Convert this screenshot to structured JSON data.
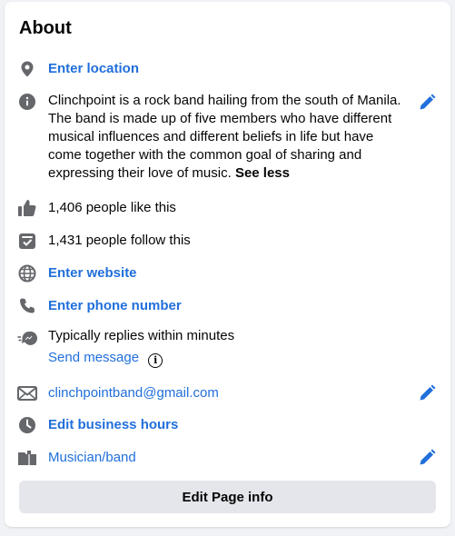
{
  "about": {
    "title": "About",
    "location": {
      "label": "Enter location",
      "icon": "location-pin-icon"
    },
    "description": {
      "text": "Clinchpoint is a rock band hailing from the south of Manila. The band is made up of five members who have different musical influences and different beliefs in life but have come together with the common goal of sharing and expressing their love of music.",
      "toggle": "See less",
      "icon": "info-icon"
    },
    "likes": {
      "text": "1,406 people like this",
      "icon": "thumbs-up-icon"
    },
    "follows": {
      "text": "1,431 people follow this",
      "icon": "follow-icon"
    },
    "website": {
      "label": "Enter website",
      "icon": "globe-icon"
    },
    "phone": {
      "label": "Enter phone number",
      "icon": "phone-icon"
    },
    "messenger": {
      "text": "Typically replies within minutes",
      "link": "Send message",
      "info_glyph": "i",
      "icon": "messenger-icon"
    },
    "email": {
      "text": "clinchpointband@gmail.com",
      "icon": "envelope-icon"
    },
    "hours": {
      "label": "Edit business hours",
      "icon": "clock-icon"
    },
    "category": {
      "text": "Musician/band",
      "icon": "category-icon"
    },
    "edit_button": "Edit Page info"
  },
  "colors": {
    "link": "#216fdb",
    "icon": "#65676b",
    "button_bg": "#e4e6eb",
    "background": "#f0f2f5"
  }
}
